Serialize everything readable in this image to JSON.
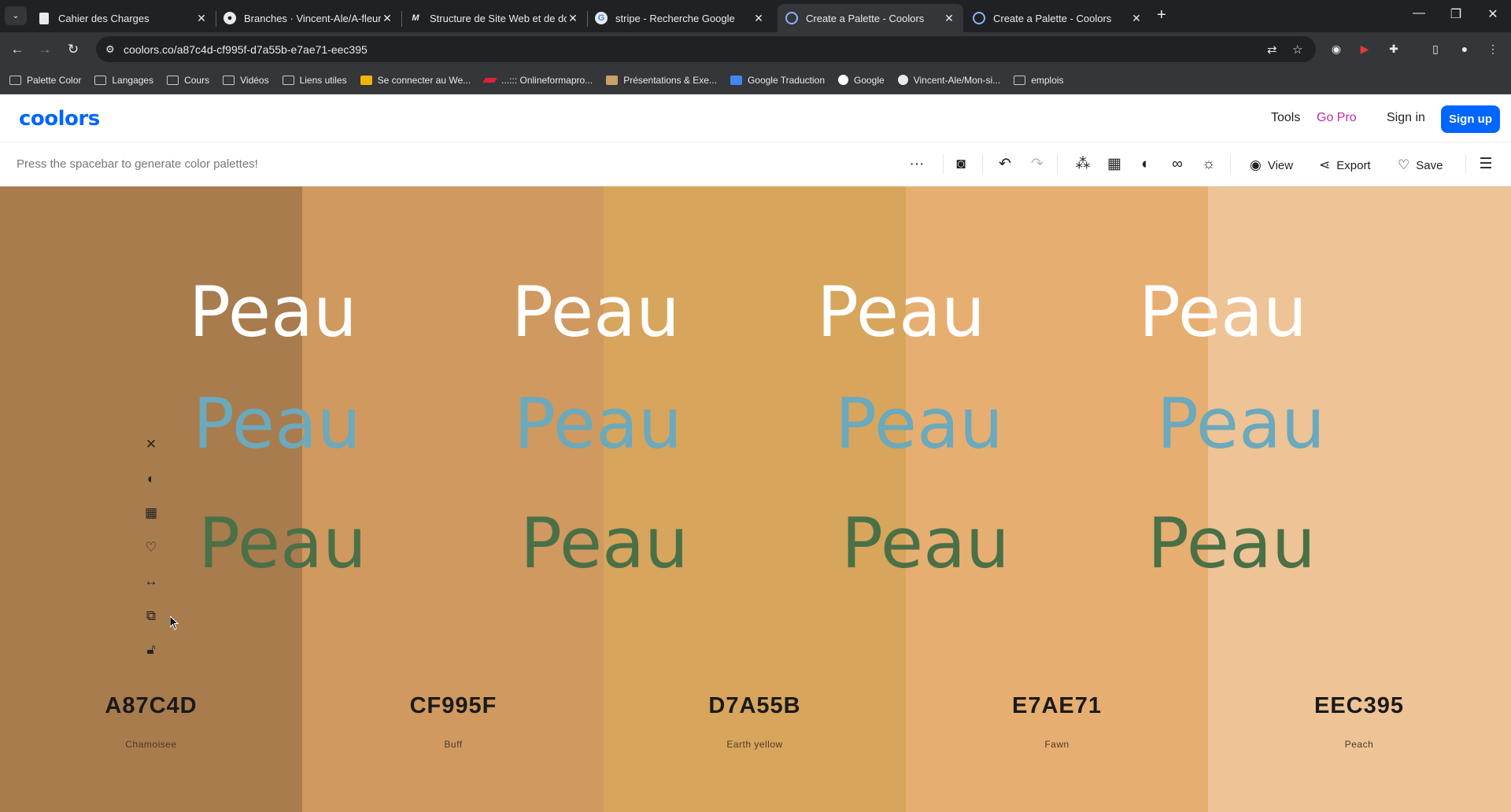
{
  "browser": {
    "tabs": [
      {
        "title": "Cahier des Charges",
        "icon": "doc-icon",
        "active": false
      },
      {
        "title": "Branches · Vincent-Ale/A-fleur-",
        "icon": "github-icon",
        "active": false
      },
      {
        "title": "Structure de Site Web et de do",
        "icon": "m-icon",
        "active": false
      },
      {
        "title": "stripe - Recherche Google",
        "icon": "google-icon",
        "active": false
      },
      {
        "title": "Create a Palette - Coolors",
        "icon": "coolors-icon",
        "active": true
      },
      {
        "title": "Create a Palette - Coolors",
        "icon": "coolors-icon",
        "active": false
      }
    ],
    "url": "coolors.co/a87c4d-cf995f-d7a55b-e7ae71-eec395",
    "bookmarks": [
      {
        "label": "Palette Color",
        "icon": "folder-icon"
      },
      {
        "label": "Langages",
        "icon": "folder-icon"
      },
      {
        "label": "Cours",
        "icon": "folder-icon"
      },
      {
        "label": "Vidéos",
        "icon": "folder-icon"
      },
      {
        "label": "Liens utiles",
        "icon": "folder-icon"
      },
      {
        "label": "Se connecter au We...",
        "icon": "mail-icon"
      },
      {
        "label": "...::: Onlineformapro...",
        "icon": "onlineformapro-icon"
      },
      {
        "label": "Présentations & Exe...",
        "icon": "presentation-icon"
      },
      {
        "label": "Google Traduction",
        "icon": "google-translate-icon"
      },
      {
        "label": "Google",
        "icon": "google-icon"
      },
      {
        "label": "Vincent-Ale/Mon-si...",
        "icon": "github-icon"
      },
      {
        "label": "emplois",
        "icon": "folder-icon"
      }
    ]
  },
  "header": {
    "logo": "coolors",
    "tools": "Tools",
    "go_pro": "Go Pro",
    "sign_in": "Sign in",
    "sign_up": "Sign up"
  },
  "toolbar": {
    "hint": "Press the spacebar to generate color palettes!",
    "view": "View",
    "export": "Export",
    "save": "Save"
  },
  "palette": {
    "sample_text": "Peau",
    "colors": [
      {
        "hex": "A87C4D",
        "name": "Chamoisee",
        "color": "#a87c4d"
      },
      {
        "hex": "CF995F",
        "name": "Buff",
        "color": "#cf995f"
      },
      {
        "hex": "D7A55B",
        "name": "Earth yellow",
        "color": "#d7a55b"
      },
      {
        "hex": "E7AE71",
        "name": "Fawn",
        "color": "#e7ae71"
      },
      {
        "hex": "EEC395",
        "name": "Peach",
        "color": "#eec395"
      }
    ],
    "text_colors": {
      "white": "#ffffff",
      "blue": "#6ba9bd",
      "green": "#4a7047"
    }
  }
}
